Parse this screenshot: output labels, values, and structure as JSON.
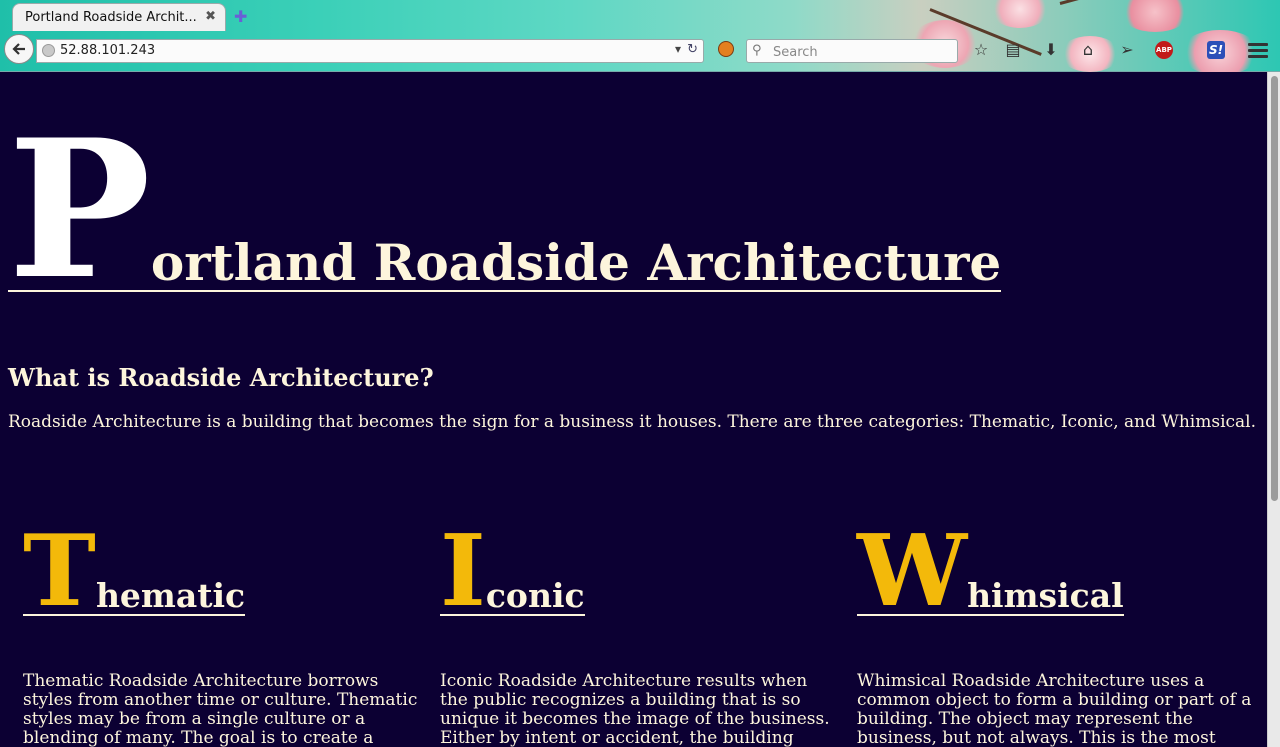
{
  "browser": {
    "tab_title": "Portland Roadside Archit...",
    "tab_close": "✖",
    "new_tab": "✚",
    "url": "52.88.101.243",
    "search_placeholder": "Search",
    "abp_label": "ABP",
    "s_label": "S!"
  },
  "site": {
    "title_initial": "P",
    "title_rest": "ortland Roadside Architecture",
    "question": "What is Roadside Architecture?",
    "intro": "Roadside Architecture is a building that becomes the sign for a business it houses. There are three categories: Thematic, Iconic, and Whimsical."
  },
  "categories": [
    {
      "initial": "T",
      "rest": "hematic",
      "text": "Thematic Roadside Architecture borrows styles from another time or culture. Thematic styles may be from a single culture or a blending of many. The goal is to create a unique experience through the architecture."
    },
    {
      "initial": "I",
      "rest": "conic",
      "text": "Iconic Roadside Architecture results when the public recognizes a building that is so unique it becomes the image of the business. Either by intent or accident, the building becomes an icon in to the surrounding area."
    },
    {
      "initial": "W",
      "rest": "himsical",
      "text": "Whimsical Roadside Architecture uses a common object to form a building or part of a building. The object may represent the business, but not always. This is the most delightful of Roadside varieties. Enjoy."
    }
  ],
  "colors": {
    "page_background": "#0c0033",
    "heading_text": "#fdf5dc",
    "accent_initial": "#f3b90a"
  }
}
